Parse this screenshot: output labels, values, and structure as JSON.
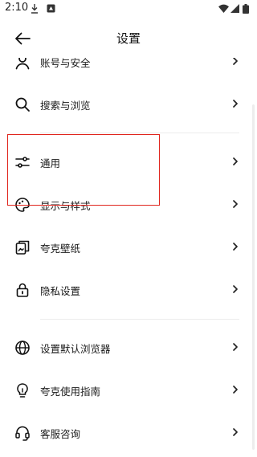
{
  "status_bar": {
    "time": "2:10",
    "icons": [
      "download-icon",
      "notification-icon",
      "wifi-icon",
      "signal-icon",
      "battery-icon"
    ]
  },
  "header": {
    "title": "设置",
    "back_icon": "arrow-left-icon"
  },
  "settings": {
    "items": [
      {
        "label": "账号与安全",
        "icon": "user-icon"
      },
      {
        "label": "搜索与浏览",
        "icon": "search-icon"
      },
      {
        "label": "通用",
        "icon": "sliders-icon"
      },
      {
        "label": "显示与样式",
        "icon": "palette-icon"
      },
      {
        "label": "夸克壁纸",
        "icon": "wallpaper-icon"
      },
      {
        "label": "隐私设置",
        "icon": "lock-icon"
      },
      {
        "label": "设置默认浏览器",
        "icon": "globe-icon"
      },
      {
        "label": "夸克使用指南",
        "icon": "lightbulb-icon"
      },
      {
        "label": "客服咨询",
        "icon": "headset-icon"
      }
    ]
  },
  "colors": {
    "highlight_border": "#e0261e",
    "text": "#1a1a1a",
    "divider": "#ececec"
  }
}
